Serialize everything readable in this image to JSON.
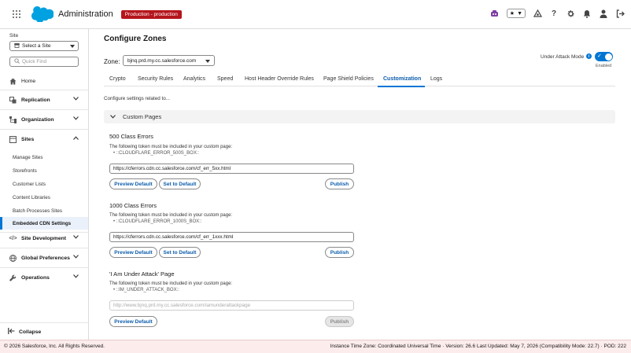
{
  "header": {
    "app_title": "Administration",
    "env_badge": "Production - production",
    "colors": {
      "env_badge": "#b5161d",
      "brand": "#0176d3"
    }
  },
  "sidebar": {
    "site_label": "Site",
    "site_select_value": "Select a Site",
    "quick_find_placeholder": "Quick Find",
    "home": "Home",
    "replication": "Replication",
    "organization": "Organization",
    "sites": "Sites",
    "sites_items": [
      "Manage Sites",
      "Storefronts",
      "Customer Lists",
      "Content Libraries",
      "Batch Processes Sites",
      "Embedded CDN Settings"
    ],
    "site_development": "Site Development",
    "global_preferences": "Global Preferences",
    "operations": "Operations",
    "collapse": "Collapse"
  },
  "main": {
    "title": "Configure Zones",
    "zone_label": "Zone:",
    "zone_value": "bjnq.prd.my.cc.salesforce.com",
    "under_attack_label": "Under Attack Mode",
    "under_attack_state": "Enabled",
    "tabs": [
      "Crypto",
      "Security Rules",
      "Analytics",
      "Speed",
      "Host Header Override Rules",
      "Page Shield Policies",
      "Customization",
      "Logs"
    ],
    "active_tab": "Customization",
    "intro_text": "Configure settings related to...",
    "accordion_title": "Custom Pages",
    "sections": [
      {
        "title": "500 Class Errors",
        "description": "The following token must be included in your custom page:",
        "token": "::CLOUDFLARE_ERROR_500S_BOX::",
        "url_value": "https://cferrors.cdn.cc.salesforce.com/cf_err_5xx.html",
        "preview_label": "Preview Default",
        "set_default_label": "Set to Default",
        "publish_label": "Publish"
      },
      {
        "title": "1000 Class Errors",
        "description": "The following token must be included in your custom page:",
        "token": "::CLOUDFLARE_ERROR_1000S_BOX::",
        "url_value": "https://cferrors.cdn.cc.salesforce.com/cf_err_1xxx.html",
        "preview_label": "Preview Default",
        "set_default_label": "Set to Default",
        "publish_label": "Publish"
      },
      {
        "title": "'I Am Under Attack' Page",
        "description": "The following token must be included in your custom page:",
        "token": "::IM_UNDER_ATTACK_BOX::",
        "url_placeholder": "http://www.bjnq.prd.my.cc.salesforce.com/iamunderattackpage",
        "preview_label": "Preview Default",
        "publish_label": "Publish"
      }
    ]
  },
  "footer": {
    "copyright": "© 2026 Salesforce, Inc. All Rights Reserved.",
    "info": "Instance Time Zone: Coordinated Universal Time · Version: 26.6 Last Updated: May 7, 2026 (Compatibility Mode: 22.7) · POD: 222"
  }
}
